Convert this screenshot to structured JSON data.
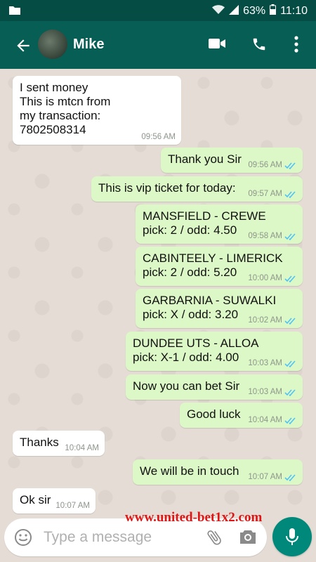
{
  "status_bar": {
    "battery": "63%",
    "time": "11:10"
  },
  "header": {
    "contact_name": "Mike"
  },
  "messages": [
    {
      "dir": "in",
      "text": "I sent money\nThis is mtcn from\nmy transaction:\n7802508314",
      "time": "09:56 AM"
    },
    {
      "dir": "out",
      "text": "Thank you Sir",
      "time": "09:56 AM"
    },
    {
      "dir": "out",
      "text": "This is vip ticket for today:",
      "time": "09:57 AM"
    },
    {
      "dir": "out",
      "text": "MANSFIELD - CREWE\npick: 2 / odd: 4.50",
      "time": "09:58 AM"
    },
    {
      "dir": "out",
      "text": "CABINTEELY - LIMERICK\npick: 2 / odd: 5.20",
      "time": "10:00 AM"
    },
    {
      "dir": "out",
      "text": "GARBARNIA - SUWALKI\npick: X / odd: 3.20",
      "time": "10:02 AM"
    },
    {
      "dir": "out",
      "text": "DUNDEE UTS - ALLOA\npick: X-1 / odd: 4.00",
      "time": "10:03 AM"
    },
    {
      "dir": "out",
      "text": "Now you can bet Sir",
      "time": "10:03 AM"
    },
    {
      "dir": "out",
      "text": "Good luck",
      "time": "10:04 AM"
    },
    {
      "dir": "in",
      "text": "Thanks",
      "time": "10:04 AM"
    },
    {
      "dir": "out",
      "text": "We will be in touch",
      "time": "10:07 AM"
    },
    {
      "dir": "in",
      "text": "Ok sir",
      "time": "10:07 AM"
    }
  ],
  "composer": {
    "placeholder": "Type a message"
  },
  "watermark": "www.united-bet1x2.com",
  "colors": {
    "header": "#075e54",
    "outgoing_bubble": "#dcf8c6",
    "incoming_bubble": "#ffffff",
    "read_tick": "#4fc3f7",
    "accent": "#00897b",
    "watermark": "#e01515"
  }
}
